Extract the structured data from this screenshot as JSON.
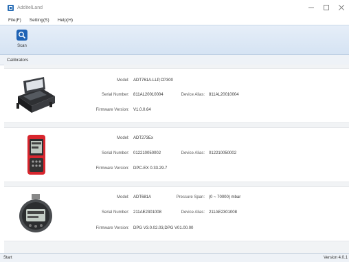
{
  "window": {
    "title": "AdditelLand"
  },
  "menu": {
    "items": [
      "File(F)",
      "Setting(S)",
      "Help(H)"
    ]
  },
  "toolbar": {
    "scan_label": "Scan"
  },
  "section": {
    "title": "Calibrators"
  },
  "labels": {
    "model": "Model:",
    "serial": "Serial Number:",
    "firmware": "Firmware Version:",
    "alias": "Device Alias:",
    "pressure_span": "Pressure Span:"
  },
  "devices": [
    {
      "model": "ADT761A-LLP,CP300",
      "serial": "811AL20010004",
      "firmware": "V1.0.0.64",
      "alias": "811AL20010004"
    },
    {
      "model": "ADT273Ex",
      "serial": "012210050002",
      "firmware": "DPC-EX 0.33.29.7",
      "alias": "012210050002"
    },
    {
      "model": "ADT681A",
      "serial": "211AE2301008",
      "firmware": "DPG V3.0.02.03,DPG V01.00.00",
      "alias": "211AE2301008",
      "pressure_span": "(0 ~ 70000) mbar"
    }
  ],
  "status": {
    "left": "Start",
    "right": "Version 4.0.1"
  },
  "icons": [
    "app-icon",
    "minimize-icon",
    "maximize-icon",
    "close-icon",
    "scan-icon"
  ],
  "colors": {
    "accent": "#1f63b5",
    "toolbar": "#dde8f5",
    "statusbar": "#eef2f7"
  }
}
